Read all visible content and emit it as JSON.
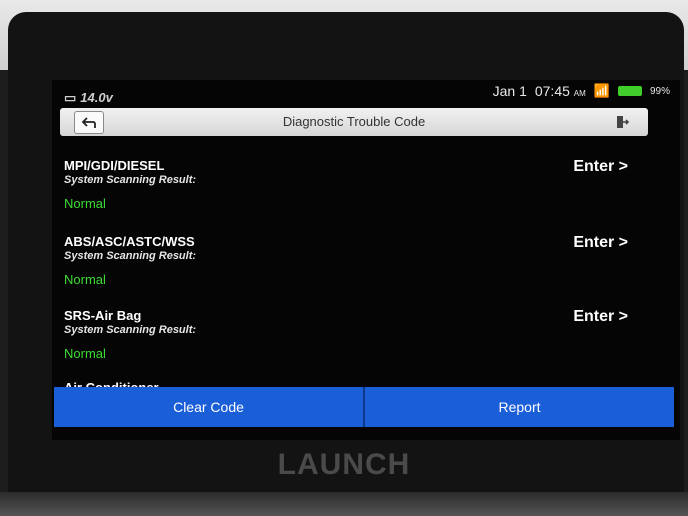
{
  "status_bar": {
    "voltage": "14.0v",
    "date": "Jan 1",
    "time": "07:45",
    "ampm": "AM",
    "battery_pct": "99%"
  },
  "title_bar": {
    "title": "Diagnostic Trouble Code"
  },
  "systems": [
    {
      "name": "MPI/GDI/DIESEL",
      "subtitle": "System Scanning Result:",
      "status": "Normal",
      "action": "Enter >"
    },
    {
      "name": "ABS/ASC/ASTC/WSS",
      "subtitle": "System Scanning Result:",
      "status": "Normal",
      "action": "Enter >"
    },
    {
      "name": "SRS-Air Bag",
      "subtitle": "System Scanning Result:",
      "status": "Normal",
      "action": "Enter >"
    },
    {
      "name": "Air Conditioner"
    }
  ],
  "actions": {
    "clear_code": "Clear Code",
    "report": "Report"
  },
  "brand": "LAUNCH",
  "colors": {
    "accent_blue": "#1a5fd8",
    "status_green": "#3ddc34",
    "battery_green": "#3fce2a"
  }
}
